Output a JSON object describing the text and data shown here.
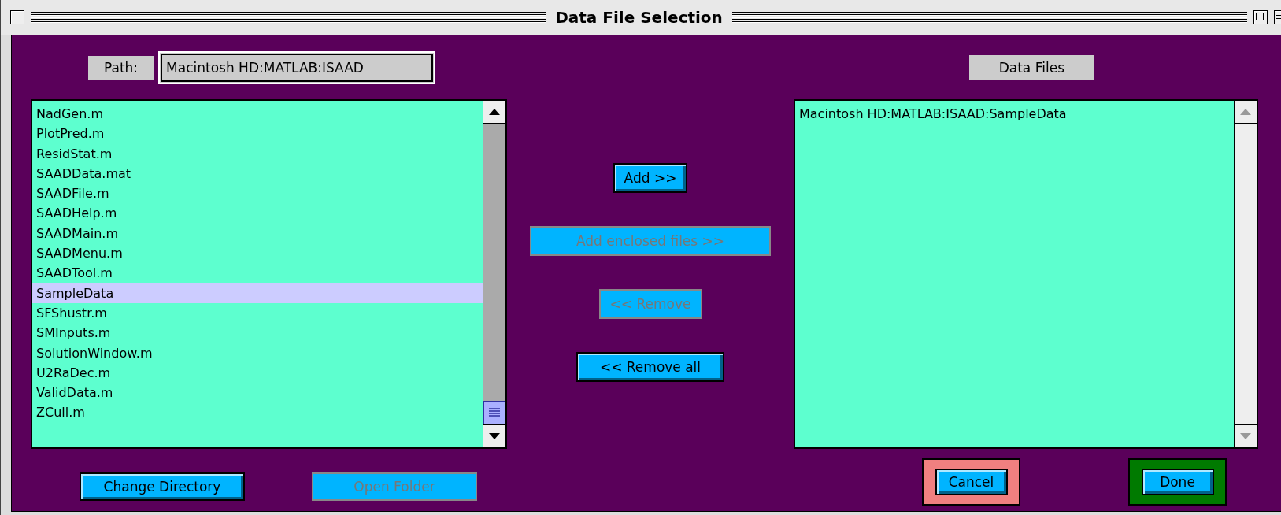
{
  "window": {
    "title": "Data File Selection"
  },
  "path": {
    "label": "Path:",
    "value": "Macintosh HD:MATLAB:ISAAD"
  },
  "data_files_label": "Data Files",
  "file_list": {
    "scrollable": true,
    "items": [
      {
        "label": "NadGen.m",
        "selected": false
      },
      {
        "label": "PlotPred.m",
        "selected": false
      },
      {
        "label": "ResidStat.m",
        "selected": false
      },
      {
        "label": "SAADData.mat",
        "selected": false
      },
      {
        "label": "SAADFile.m",
        "selected": false
      },
      {
        "label": "SAADHelp.m",
        "selected": false
      },
      {
        "label": "SAADMain.m",
        "selected": false
      },
      {
        "label": "SAADMenu.m",
        "selected": false
      },
      {
        "label": "SAADTool.m",
        "selected": false
      },
      {
        "label": "SampleData",
        "selected": true
      },
      {
        "label": "SFShustr.m",
        "selected": false
      },
      {
        "label": "SMInputs.m",
        "selected": false
      },
      {
        "label": "SolutionWindow.m",
        "selected": false
      },
      {
        "label": "U2RaDec.m",
        "selected": false
      },
      {
        "label": "ValidData.m",
        "selected": false
      },
      {
        "label": "ZCull.m",
        "selected": false
      }
    ]
  },
  "middle_buttons": [
    {
      "label": "Add >>",
      "disabled": false
    },
    {
      "label": "Add enclosed files >>",
      "disabled": true
    },
    {
      "label": "<< Remove",
      "disabled": true
    },
    {
      "label": "<< Remove all",
      "disabled": false
    }
  ],
  "data_list": {
    "scrollable": false,
    "items": [
      {
        "label": "Macintosh HD:MATLAB:ISAAD:SampleData",
        "selected": false
      }
    ]
  },
  "left_buttons": [
    {
      "label": "Change Directory",
      "disabled": false
    },
    {
      "label": "Open Folder",
      "disabled": true
    }
  ],
  "right_buttons": [
    {
      "label": "Cancel",
      "disabled": false,
      "color": "#f08080"
    },
    {
      "label": "Done",
      "disabled": false,
      "color": "#007a00"
    }
  ]
}
